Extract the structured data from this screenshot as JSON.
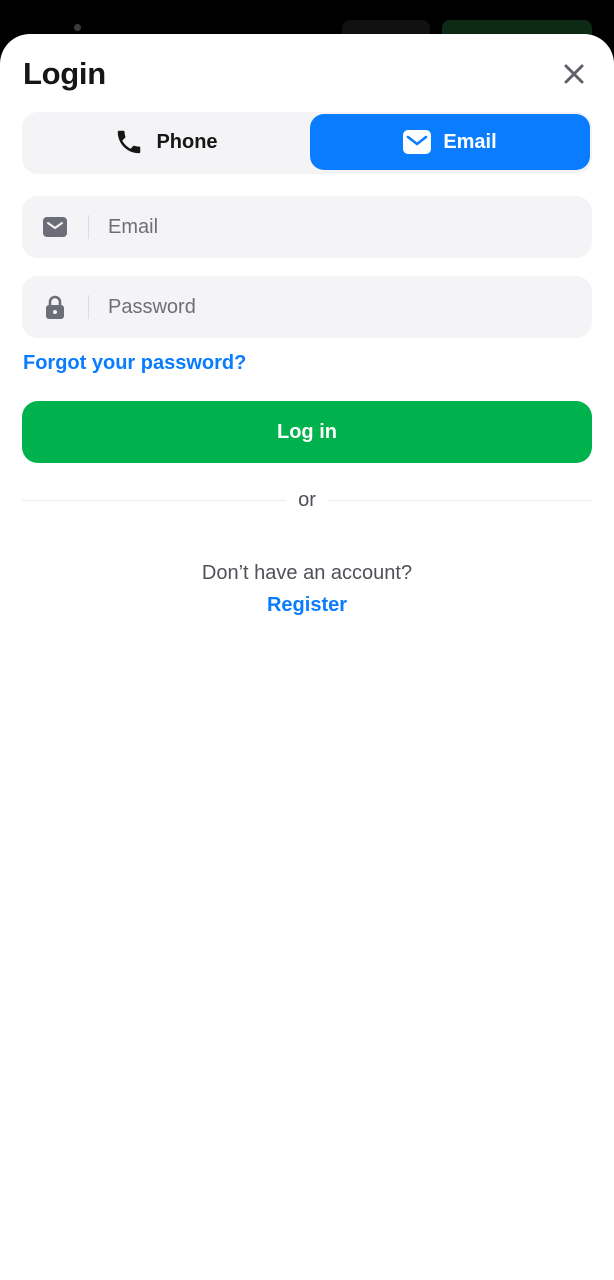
{
  "header": {
    "title": "Login",
    "close_icon": "close-icon"
  },
  "tabs": [
    {
      "label": "Phone",
      "icon": "phone-icon",
      "selected": false
    },
    {
      "label": "Email",
      "icon": "envelope-icon",
      "selected": true
    }
  ],
  "form": {
    "email": {
      "placeholder": "Email",
      "value": "",
      "icon": "envelope-icon"
    },
    "password": {
      "placeholder": "Password",
      "value": "",
      "icon": "lock-icon"
    },
    "forgot_label": "Forgot your password?",
    "submit_label": "Log in",
    "divider_label": "or"
  },
  "footer": {
    "prompt": "Don’t have an account?",
    "register_label": "Register"
  },
  "colors": {
    "accent_blue": "#0a7cff",
    "submit_green": "#00b24d",
    "field_bg": "#f4f4f6",
    "text_dark": "#161616"
  }
}
